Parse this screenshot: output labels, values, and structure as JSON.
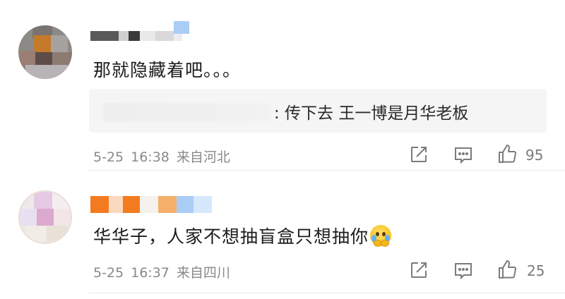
{
  "comments": [
    {
      "text": "那就隐藏着吧。。。",
      "quote": {
        "text": ": 传下去 王一博是月华老板"
      },
      "date": "5-25",
      "time": "16:38",
      "location": "来自河北",
      "likes": "95"
    },
    {
      "text": "华华子，人家不想抽盲盒只想抽你",
      "emoji": "crying-face-emoji",
      "date": "5-25",
      "time": "16:37",
      "location": "来自四川",
      "likes": "25"
    }
  ],
  "icons": {
    "share": "share-icon",
    "reply": "comment-icon",
    "like": "thumbs-up-icon"
  },
  "colors": {
    "meta_text": "#8a8a8a",
    "quote_bg": "#f5f5f5",
    "divider": "#e8e8e8",
    "mosaic_orange": "#f37a1f",
    "mosaic_blue": "#a9cdf5"
  }
}
